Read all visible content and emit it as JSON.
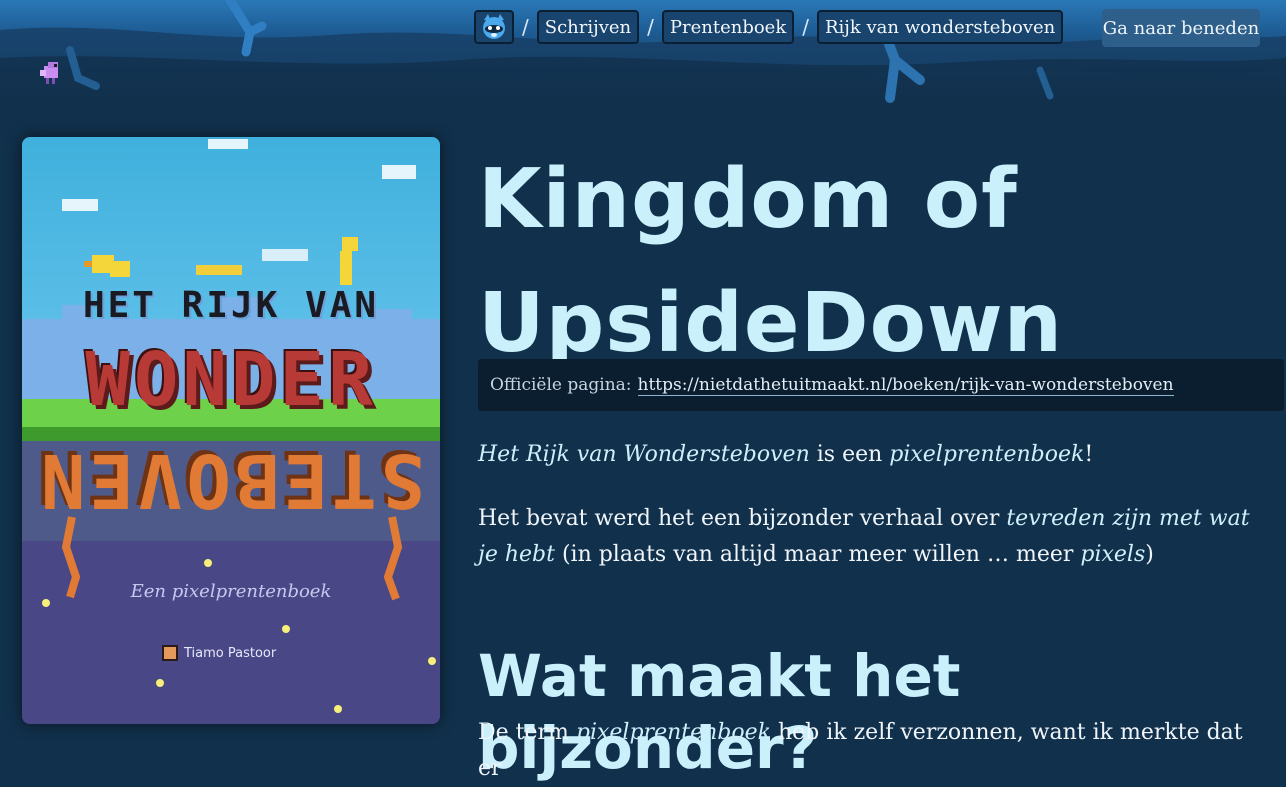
{
  "nav": {
    "home_icon": "raccoon-logo-icon",
    "separator": "/",
    "crumbs": [
      "Schrijven",
      "Prentenboek",
      "Rijk van wondersteboven"
    ],
    "goto_label": "Ga naar beneden"
  },
  "cover": {
    "title_line1": "HET RIJK VAN",
    "title_line2": "WONDER",
    "title_line3": "STEBOVEN",
    "subtitle": "Een pixelprentenboek",
    "author": "Tiamo Pastoor"
  },
  "article": {
    "title": "Kingdom of UpsideDown",
    "official_label": "Officiële pagina:",
    "official_url": "https://nietdathetuitmaakt.nl/boeken/rijk-van-wondersteboven",
    "p1": {
      "a": "Het Rijk van Wondersteboven",
      "b": " is een ",
      "c": "pixelprentenboek",
      "d": "!"
    },
    "p2": {
      "a": "Het bevat werd het een bijzonder verhaal over ",
      "b": "tevreden zijn met wat je hebt",
      "c": " (in plaats van altijd maar meer willen … meer ",
      "d": "pixels",
      "e": ")"
    },
    "h2": "Wat maakt het bijzonder?",
    "p3": {
      "a": "De term ",
      "b": "pixelprentenboek",
      "c": " heb ik zelf verzonnen, want ik merkte dat er"
    }
  },
  "colors": {
    "background": "#11304b",
    "heading": "#c9f0fb",
    "banner": "#1d5b93"
  }
}
